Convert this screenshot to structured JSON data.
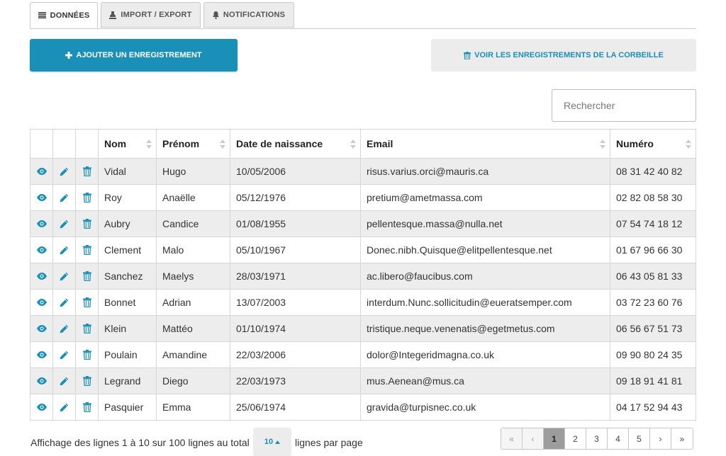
{
  "tabs": [
    {
      "label": "DONNÉES",
      "icon": "list-icon",
      "active": true
    },
    {
      "label": "IMPORT / EXPORT",
      "icon": "stamp-icon",
      "active": false
    },
    {
      "label": "NOTIFICATIONS",
      "icon": "bell-icon",
      "active": false
    }
  ],
  "actions": {
    "add_label": "AJOUTER UN ENREGISTREMENT",
    "trash_label": "VOIR LES ENREGISTREMENTS DE LA CORBEILLE"
  },
  "search": {
    "placeholder": "Rechercher",
    "value": ""
  },
  "table": {
    "columns": [
      "Nom",
      "Prénom",
      "Date de naissance",
      "Email",
      "Numéro"
    ],
    "row_actions": [
      "eye-icon",
      "pencil-icon",
      "trash-icon"
    ],
    "rows": [
      {
        "nom": "Vidal",
        "prenom": "Hugo",
        "date": "10/05/2006",
        "email": "risus.varius.orci@mauris.ca",
        "numero": "08 31 42 40 82"
      },
      {
        "nom": "Roy",
        "prenom": "Anaëlle",
        "date": "05/12/1976",
        "email": "pretium@ametmassa.com",
        "numero": "02 82 08 58 30"
      },
      {
        "nom": "Aubry",
        "prenom": "Candice",
        "date": "01/08/1955",
        "email": "pellentesque.massa@nulla.net",
        "numero": "07 54 74 18 12"
      },
      {
        "nom": "Clement",
        "prenom": "Malo",
        "date": "05/10/1967",
        "email": "Donec.nibh.Quisque@elitpellentesque.net",
        "numero": "01 67 96 66 30"
      },
      {
        "nom": "Sanchez",
        "prenom": "Maelys",
        "date": "28/03/1971",
        "email": "ac.libero@faucibus.com",
        "numero": "06 43 05 81 33"
      },
      {
        "nom": "Bonnet",
        "prenom": "Adrian",
        "date": "13/07/2003",
        "email": "interdum.Nunc.sollicitudin@eueratsemper.com",
        "numero": "03 72 23 60 76"
      },
      {
        "nom": "Klein",
        "prenom": "Mattéo",
        "date": "01/10/1974",
        "email": "tristique.neque.venenatis@egetmetus.com",
        "numero": "06 56 67 51 73"
      },
      {
        "nom": "Poulain",
        "prenom": "Amandine",
        "date": "22/03/2006",
        "email": "dolor@Integeridmagna.co.uk",
        "numero": "09 90 80 24 35"
      },
      {
        "nom": "Legrand",
        "prenom": "Diego",
        "date": "22/03/1973",
        "email": "mus.Aenean@mus.ca",
        "numero": "09 18 91 41 81"
      },
      {
        "nom": "Pasquier",
        "prenom": "Emma",
        "date": "25/06/1974",
        "email": "gravida@turpisnec.co.uk",
        "numero": "04 17 52 94 43"
      }
    ]
  },
  "footer": {
    "info": "Affichage des lignes 1 à 10 sur 100 lignes au total",
    "per_page_value": "10",
    "per_page_label": "lignes par page",
    "pagination": [
      "«",
      "‹",
      "1",
      "2",
      "3",
      "4",
      "5",
      "›",
      "»"
    ],
    "current_page": "1"
  },
  "colors": {
    "accent": "#1a8fb7",
    "stripe": "#ededed",
    "tab_bg": "#ececec"
  }
}
